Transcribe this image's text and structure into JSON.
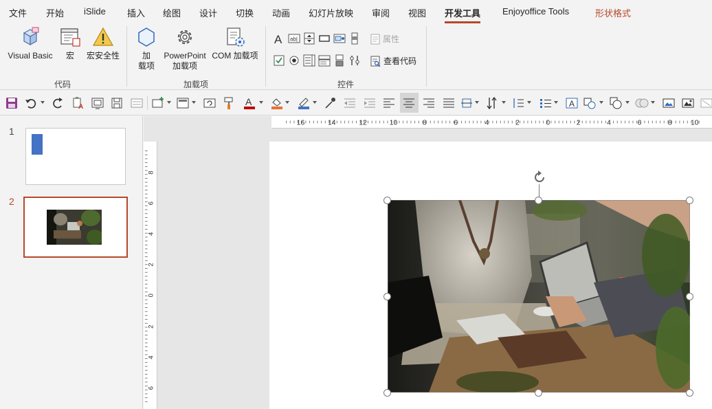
{
  "tabs": [
    "文件",
    "开始",
    "iSlide",
    "插入",
    "绘图",
    "设计",
    "切换",
    "动画",
    "幻灯片放映",
    "审阅",
    "视图",
    "开发工具",
    "Enjoyoffice Tools",
    "形状格式"
  ],
  "ribbon": {
    "groups": {
      "code": {
        "label": "代码",
        "visual_basic": "Visual Basic",
        "macros": "宏",
        "macro_security": "宏安全性"
      },
      "addins": {
        "label": "加载项",
        "addins_line1": "加",
        "addins_line2": "载项",
        "ppt_addins_line1": "PowerPoint",
        "ppt_addins_line2": "加载项",
        "com_addins": "COM 加载项"
      },
      "controls": {
        "label": "控件",
        "properties": "属性",
        "view_code": "查看代码"
      }
    }
  },
  "slides_pane": {
    "numbers": [
      "1",
      "2"
    ]
  },
  "rulers": {
    "horizontal": [
      "16",
      "14",
      "12",
      "10",
      "8",
      "6",
      "4",
      "2",
      "0",
      "2",
      "4",
      "6",
      "8",
      "10"
    ],
    "vertical": [
      "8",
      "6",
      "4",
      "2",
      "0",
      "2",
      "4",
      "6"
    ]
  },
  "colors": {
    "accent": "#b7472a",
    "font_color_bar": "#c00000",
    "fill_color_bar": "#e97132",
    "line_color_bar": "#4472c4",
    "slide1_shape": "#4472c4"
  }
}
